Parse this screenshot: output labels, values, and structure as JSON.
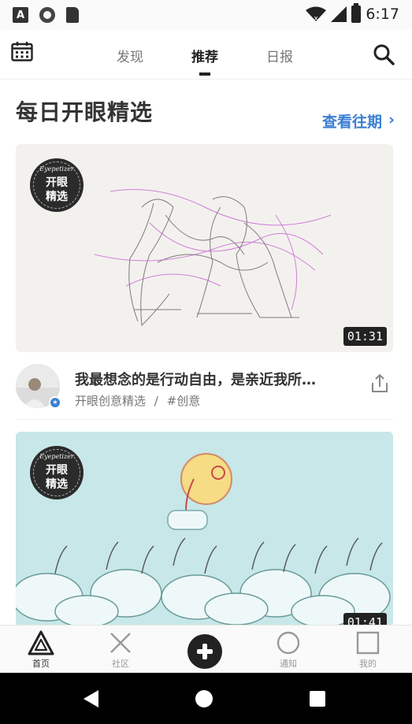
{
  "status_bar": {
    "time": "6:17"
  },
  "top_nav": {
    "tabs": [
      {
        "label": "发现"
      },
      {
        "label": "推荐"
      },
      {
        "label": "日报"
      }
    ],
    "active_tab": "推荐"
  },
  "section": {
    "title": "每日开眼精选",
    "view_past": "查看往期"
  },
  "badge": {
    "brand": "Eyepetizer",
    "line1": "开眼",
    "line2": "精选"
  },
  "feed": [
    {
      "duration": "01:31",
      "title": "我最想念的是行动自由，是亲近我所…",
      "author": "开眼创意精选",
      "separator": "/",
      "tag": "#创意"
    },
    {
      "duration": "01:41"
    }
  ],
  "bottom_tabs": [
    {
      "label": "首页",
      "icon": "triangle-icon"
    },
    {
      "label": "社区",
      "icon": "x-icon"
    },
    {
      "label": "",
      "icon": "add-icon"
    },
    {
      "label": "通知",
      "icon": "circle-icon"
    },
    {
      "label": "我的",
      "icon": "square-icon"
    }
  ],
  "colors": {
    "accent": "#3b7fd3",
    "dark": "#222222"
  }
}
